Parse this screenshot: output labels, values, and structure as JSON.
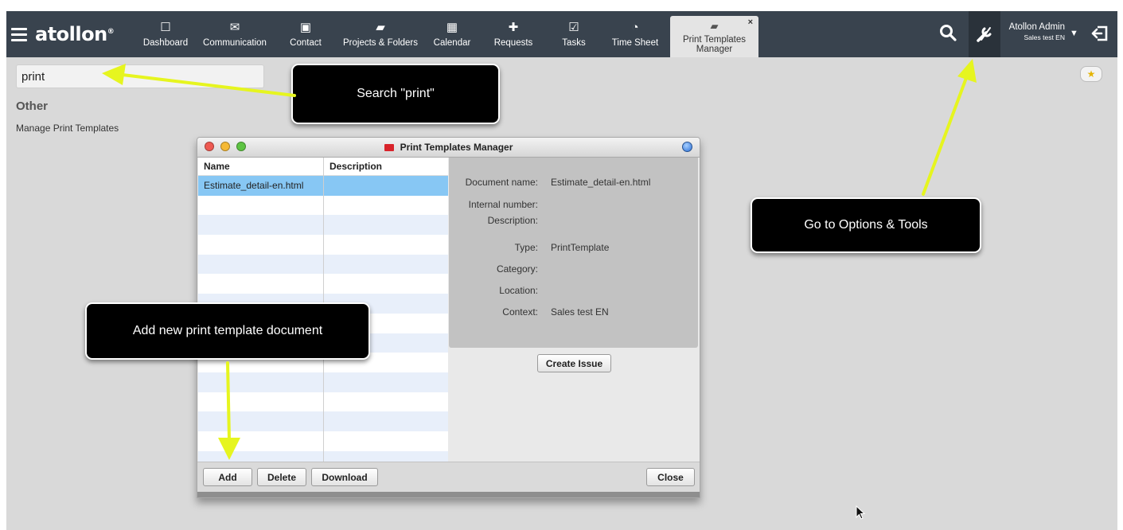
{
  "topbar": {
    "logo": "atollon",
    "logo_mark": "®",
    "nav": [
      {
        "label": "Dashboard",
        "icon": "dashboard-icon",
        "glyph": "☐"
      },
      {
        "label": "Communication",
        "icon": "envelope-icon",
        "glyph": "✉"
      },
      {
        "label": "Contact",
        "icon": "contact-card-icon",
        "glyph": "▣"
      },
      {
        "label": "Projects & Folders",
        "icon": "folder-icon",
        "glyph": "▰"
      },
      {
        "label": "Calendar",
        "icon": "calendar-icon",
        "glyph": "▦"
      },
      {
        "label": "Requests",
        "icon": "requests-icon",
        "glyph": "✚"
      },
      {
        "label": "Tasks",
        "icon": "task-check-icon",
        "glyph": "☑"
      },
      {
        "label": "Time Sheet",
        "icon": "time-sheet-icon",
        "glyph": "◔"
      }
    ],
    "active_tab": {
      "label": "Print Templates Manager",
      "line1": "Print Templates",
      "line2": "Manager",
      "icon": "print-templates-icon",
      "close": "×"
    },
    "user": {
      "name": "Atollon Admin",
      "context": "Sales test EN",
      "dropdown": "▼"
    },
    "icons": {
      "search": "search-icon",
      "tools": "options-tools-icon",
      "logout": "logout-icon"
    }
  },
  "search": {
    "value": "print"
  },
  "results": {
    "section": "Other",
    "item": "Manage Print Templates"
  },
  "callouts": {
    "search": "Search \"print\"",
    "tools": "Go to Options & Tools",
    "add": "Add new print template document"
  },
  "window": {
    "title": "Print Templates Manager",
    "columns": [
      "Name",
      "Description"
    ],
    "rows": [
      {
        "name": "Estimate_detail-en.html",
        "description": ""
      }
    ],
    "details": [
      {
        "label": "Document name:",
        "value": "Estimate_detail-en.html"
      },
      {
        "label": "Internal number:",
        "value": ""
      },
      {
        "label": "Description:",
        "value": ""
      },
      {
        "label": "Type:",
        "value": "PrintTemplate"
      },
      {
        "label": "Category:",
        "value": ""
      },
      {
        "label": "Location:",
        "value": ""
      },
      {
        "label": "Context:",
        "value": "Sales test EN"
      }
    ],
    "buttons": {
      "create_issue": "Create Issue",
      "add": "Add",
      "delete": "Delete",
      "download": "Download",
      "close": "Close"
    }
  },
  "colors": {
    "topbar": "#39434e",
    "background": "#d9d9d9",
    "selection": "#87c7f4",
    "arrow": "#e6f51f",
    "callout": "#000000"
  }
}
